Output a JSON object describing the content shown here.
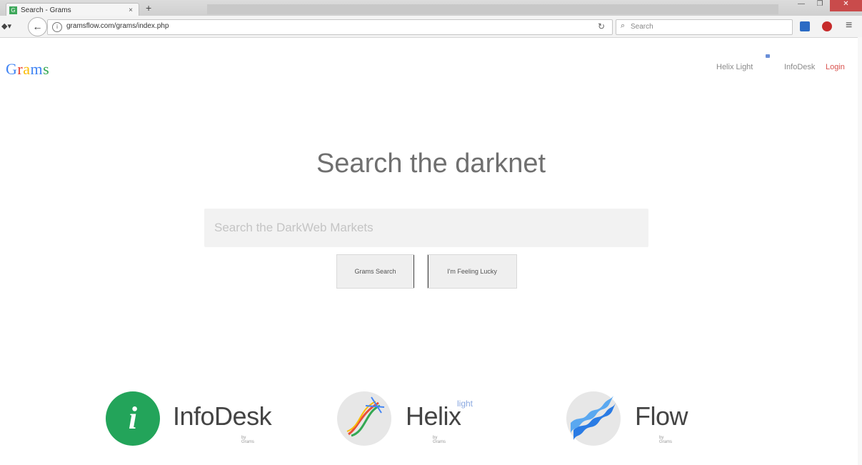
{
  "browser": {
    "tab_title": "Search - Grams",
    "tab_close": "×",
    "new_tab": "+",
    "url": "gramsflow.com/grams/index.php",
    "search_placeholder": "Search",
    "win_min": "—",
    "win_max": "❐",
    "win_close": "✕"
  },
  "page": {
    "logo_letters": [
      "G",
      "r",
      "a",
      "m",
      "s",
      ""
    ],
    "nav": {
      "helix": "Helix Light",
      "infodesk": "InfoDesk",
      "login": "Login"
    },
    "headline": "Search the darknet",
    "search_placeholder": "Search the DarkWeb Markets",
    "button_search": "Grams Search",
    "button_lucky": "I'm Feeling Lucky"
  },
  "products": [
    {
      "name": "InfoDesk",
      "by": "by Grams",
      "icon": "infodesk-i-icon",
      "color": "#23a45a"
    },
    {
      "name": "Helix",
      "light": "light",
      "by": "by Grams",
      "icon": "dna-helix-icon"
    },
    {
      "name": "Flow",
      "by": "by Grams",
      "icon": "blue-wave-icon"
    }
  ]
}
